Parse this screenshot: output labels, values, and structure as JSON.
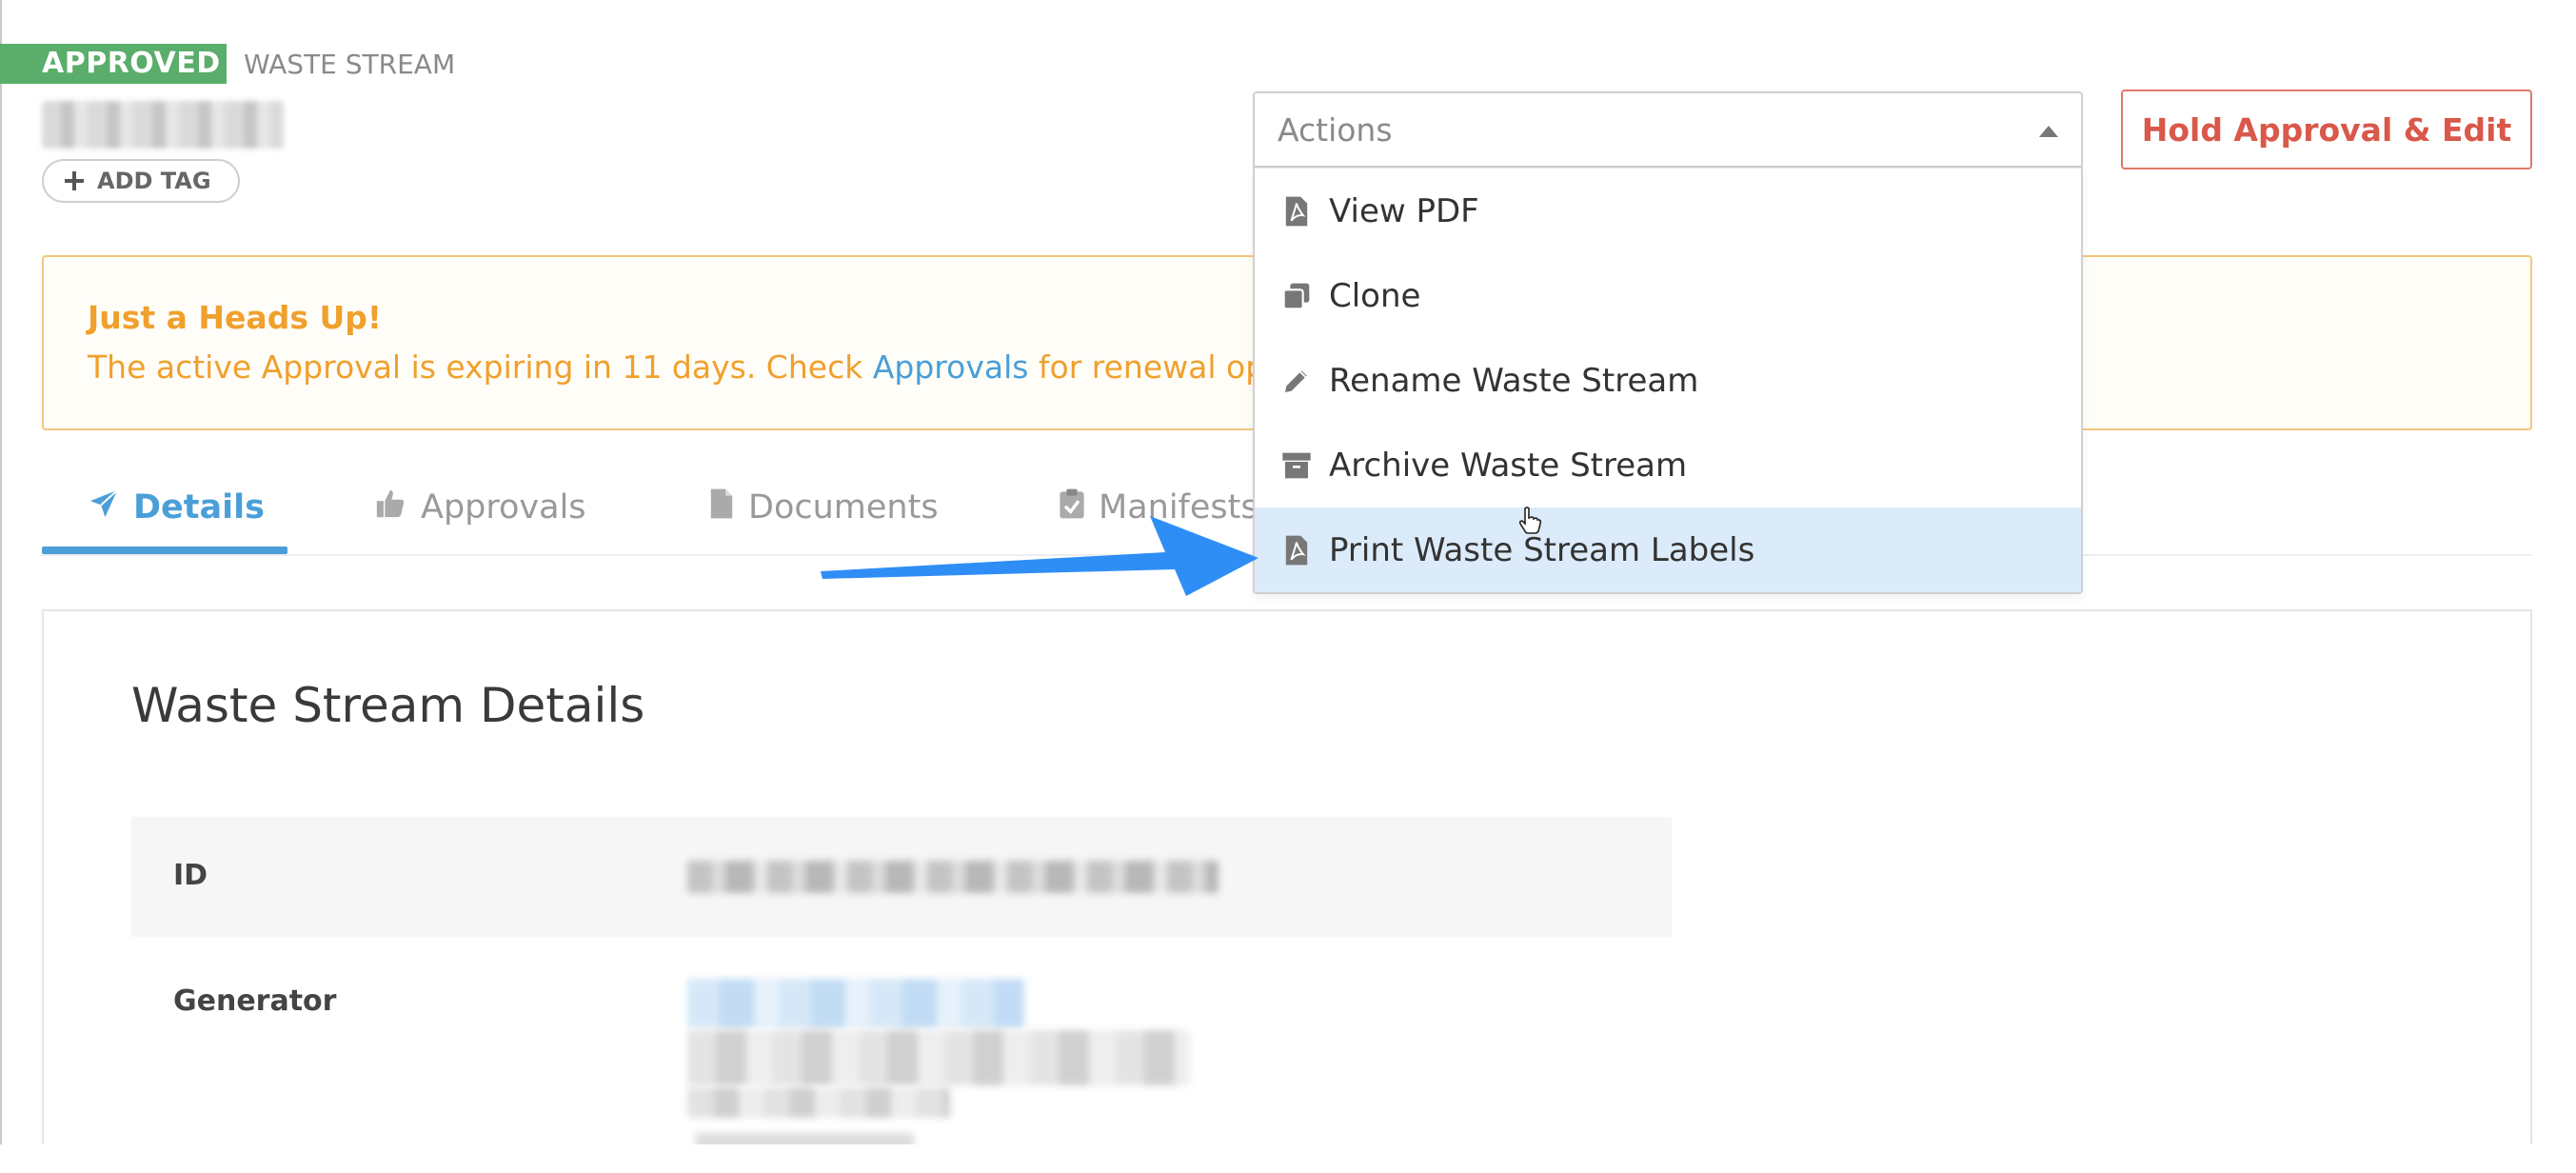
{
  "header": {
    "status_badge": "APPROVED",
    "type_label": "WASTE STREAM",
    "add_tag_label": "ADD TAG",
    "hold_button_label": "Hold Approval & Edit"
  },
  "alert": {
    "title": "Just a Heads Up!",
    "message_before": "The active Approval is expiring in 11 days. Check ",
    "link": "Approvals",
    "message_after": " for renewal optio"
  },
  "tabs": [
    {
      "label": "Details",
      "icon": "paper-plane-icon",
      "active": true
    },
    {
      "label": "Approvals",
      "icon": "thumbs-up-icon",
      "active": false
    },
    {
      "label": "Documents",
      "icon": "document-icon",
      "active": false
    },
    {
      "label": "Manifests",
      "icon": "clipboard-check-icon",
      "active": false
    }
  ],
  "actions": {
    "placeholder": "Actions",
    "items": [
      {
        "label": "View PDF",
        "icon": "pdf-file-icon"
      },
      {
        "label": "Clone",
        "icon": "copy-icon"
      },
      {
        "label": "Rename Waste Stream",
        "icon": "pencil-icon"
      },
      {
        "label": "Archive Waste Stream",
        "icon": "archive-icon"
      },
      {
        "label": "Print Waste Stream Labels",
        "icon": "pdf-file-icon",
        "highlighted": true
      }
    ]
  },
  "details": {
    "title": "Waste Stream Details",
    "id_label": "ID",
    "generator_label": "Generator"
  },
  "colors": {
    "accent": "#4a9fd8",
    "approved": "#5aad6a",
    "warning": "#f0a02c",
    "danger": "#d9584a",
    "arrow": "#2f8ef5"
  }
}
